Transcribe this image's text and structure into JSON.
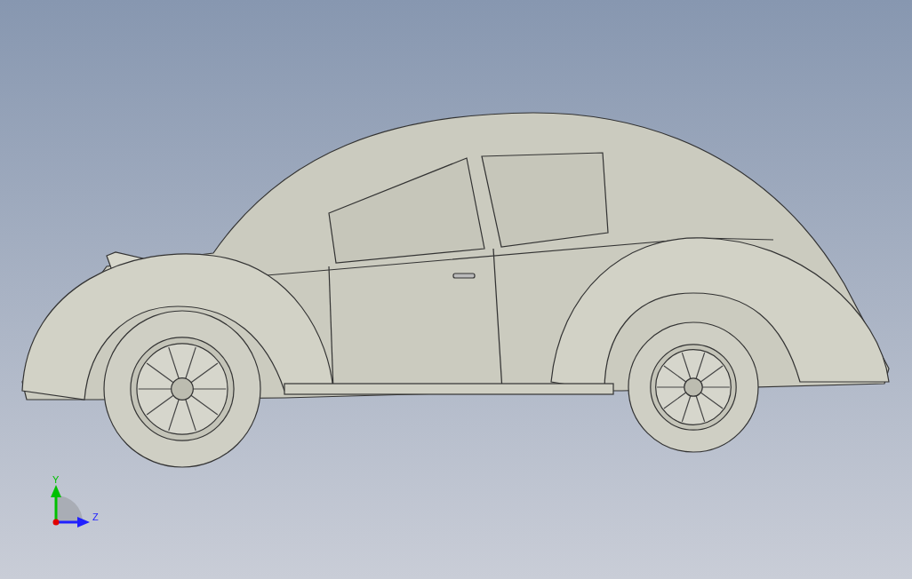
{
  "viewport": {
    "model": {
      "kind": "car"
    },
    "triad": [
      {
        "kind": "vertical",
        "label": "Y",
        "color": "#00c000"
      },
      {
        "kind": "horizontal",
        "label": "Z",
        "color": "#2020ff"
      }
    ]
  }
}
